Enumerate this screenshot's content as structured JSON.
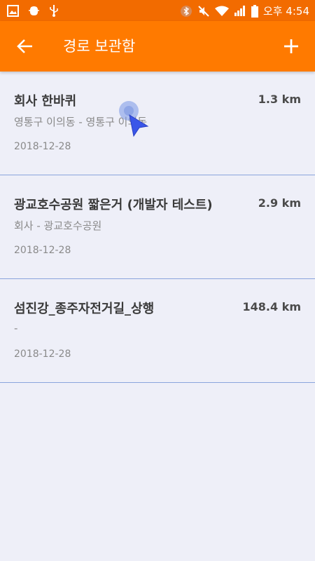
{
  "status_bar": {
    "time": "오후 4:54",
    "left_icons": [
      "image-icon",
      "android-debug-icon",
      "usb-icon"
    ],
    "right_icons": [
      "bluetooth-icon",
      "mute-icon",
      "wifi-icon",
      "signal-icon",
      "battery-icon"
    ]
  },
  "app_bar": {
    "title": "경로 보관함",
    "back_icon": "arrow-back-icon",
    "add_icon": "plus-icon"
  },
  "routes": [
    {
      "name": "회사 한바퀴",
      "distance": "1.3 km",
      "path": "영통구 이의동 - 영통구 이의동",
      "date": "2018-12-28"
    },
    {
      "name": "광교호수공원 짧은거 (개발자 테스트)",
      "distance": "2.9 km",
      "path": "회사 - 광교호수공원",
      "date": "2018-12-28"
    },
    {
      "name": "섬진강_종주자전거길_상행",
      "distance": "148.4 km",
      "path": " -",
      "date": "2018-12-28"
    }
  ],
  "colors": {
    "app_bar": "#ff7a00",
    "status_bar": "#f26b00",
    "background": "#eeeff8",
    "divider": "#8aa4dd"
  }
}
